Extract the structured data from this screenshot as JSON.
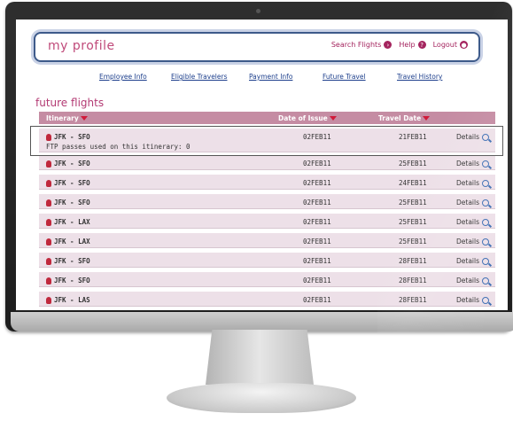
{
  "header": {
    "brand": "my profile",
    "search_label": "Search Flights",
    "help_label": "Help",
    "logout_label": "Logout"
  },
  "tabs": [
    "Employee Info",
    "Eligible Travelers",
    "Payment Info",
    "Future Travel",
    "Travel History"
  ],
  "section_title": "future flights",
  "table": {
    "columns": [
      "Itinerary",
      "Date of Issue",
      "Travel Date"
    ],
    "rows": [
      {
        "itinerary": "JFK - SFO",
        "issue": "02FEB11",
        "travel": "21FEB11",
        "details": "Details",
        "note": "FTP passes used on this itinerary: 0"
      },
      {
        "itinerary": "JFK - SFO",
        "issue": "02FEB11",
        "travel": "25FEB11",
        "details": "Details"
      },
      {
        "itinerary": "JFK - SFO",
        "issue": "02FEB11",
        "travel": "24FEB11",
        "details": "Details"
      },
      {
        "itinerary": "JFK - SFO",
        "issue": "02FEB11",
        "travel": "25FEB11",
        "details": "Details"
      },
      {
        "itinerary": "JFK - LAX",
        "issue": "02FEB11",
        "travel": "25FEB11",
        "details": "Details"
      },
      {
        "itinerary": "JFK - LAX",
        "issue": "02FEB11",
        "travel": "25FEB11",
        "details": "Details"
      },
      {
        "itinerary": "JFK - SFO",
        "issue": "02FEB11",
        "travel": "28FEB11",
        "details": "Details"
      },
      {
        "itinerary": "JFK - SFO",
        "issue": "02FEB11",
        "travel": "28FEB11",
        "details": "Details"
      },
      {
        "itinerary": "JFK - LAS",
        "issue": "02FEB11",
        "travel": "28FEB11",
        "details": "Details"
      }
    ]
  }
}
